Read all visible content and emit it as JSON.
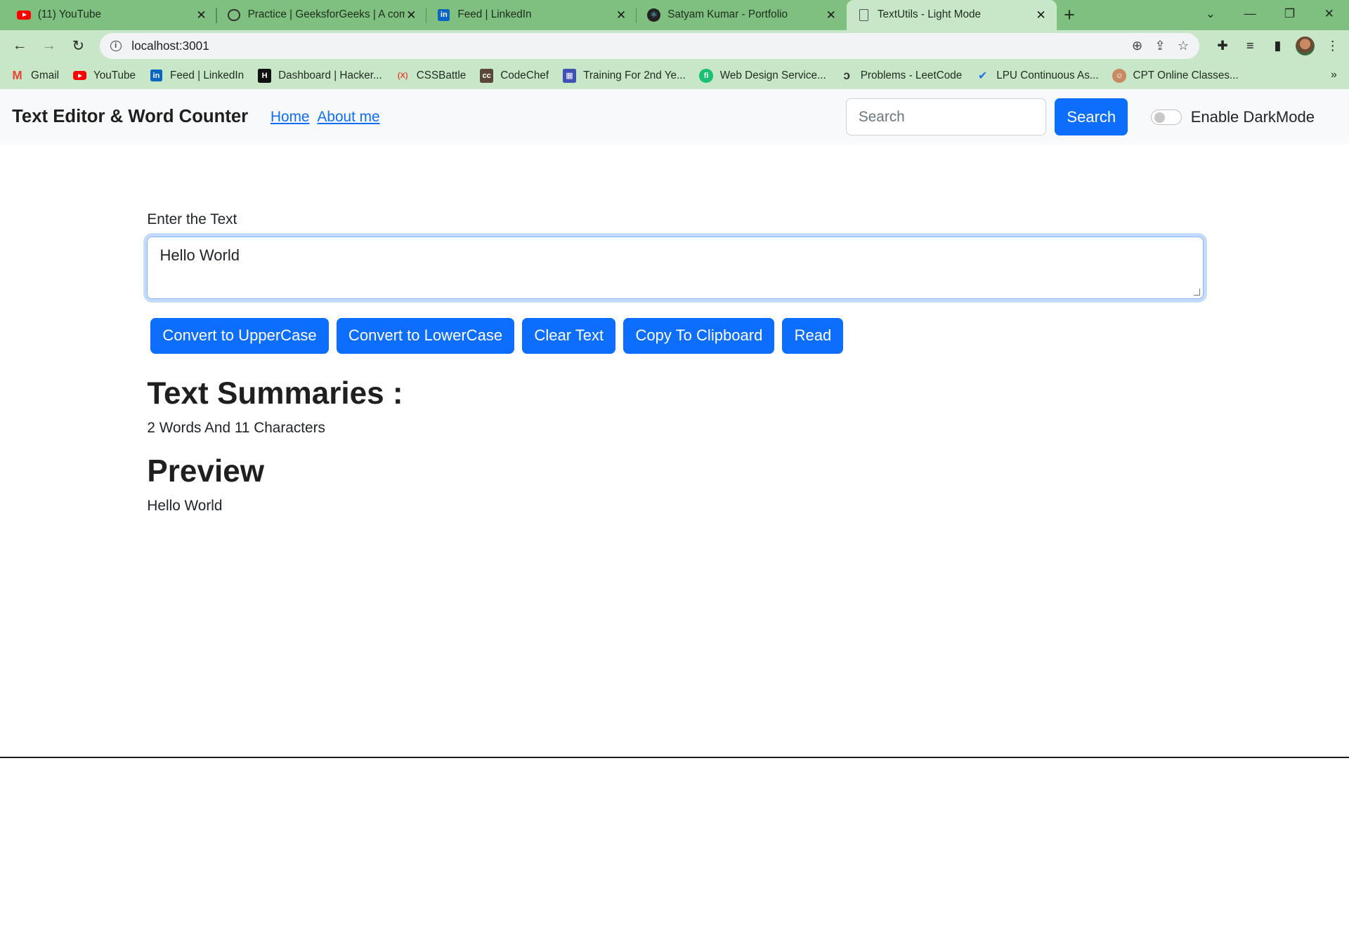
{
  "browser": {
    "tabs": [
      {
        "title": "(11) YouTube",
        "icon": "youtube-icon"
      },
      {
        "title": "Practice | GeeksforGeeks | A com",
        "icon": "globe-icon"
      },
      {
        "title": "Feed | LinkedIn",
        "icon": "linkedin-icon"
      },
      {
        "title": "Satyam Kumar - Portfolio",
        "icon": "react-icon"
      },
      {
        "title": "TextUtils - Light Mode",
        "icon": "document-icon",
        "active": true
      }
    ],
    "url": "localhost:3001",
    "bookmarks": [
      {
        "label": "Gmail",
        "icon": "gmail-icon"
      },
      {
        "label": "YouTube",
        "icon": "youtube-icon"
      },
      {
        "label": "Feed | LinkedIn",
        "icon": "linkedin-icon"
      },
      {
        "label": "Dashboard | Hacker...",
        "icon": "hackerrank-icon"
      },
      {
        "label": "CSSBattle",
        "icon": "cssbattle-icon"
      },
      {
        "label": "CodeChef",
        "icon": "codechef-icon"
      },
      {
        "label": "Training For 2nd Ye...",
        "icon": "calendar-icon"
      },
      {
        "label": "Web Design Service...",
        "icon": "fiverr-icon"
      },
      {
        "label": "Problems - LeetCode",
        "icon": "leetcode-icon"
      },
      {
        "label": "LPU Continuous As...",
        "icon": "check-icon"
      },
      {
        "label": "CPT Online Classes...",
        "icon": "user-icon"
      }
    ]
  },
  "navbar": {
    "brand": "Text Editor & Word Counter",
    "links": [
      "Home",
      "About me"
    ],
    "search_placeholder": "Search",
    "search_button": "Search",
    "toggle_label": "Enable DarkMode",
    "toggle_on": false
  },
  "main": {
    "label": "Enter the Text",
    "text": "Hello World",
    "buttons": [
      "Convert to UpperCase",
      "Convert to LowerCase",
      "Clear Text",
      "Copy To Clipboard",
      "Read"
    ],
    "summary_heading": "Text Summaries :",
    "summary_text": "2 Words And 11 Characters",
    "preview_heading": "Preview",
    "preview_text": "Hello World"
  },
  "colors": {
    "browser_frame": "#7fbf7f",
    "toolbar": "#c8e6c8",
    "primary": "#0d6efd"
  }
}
